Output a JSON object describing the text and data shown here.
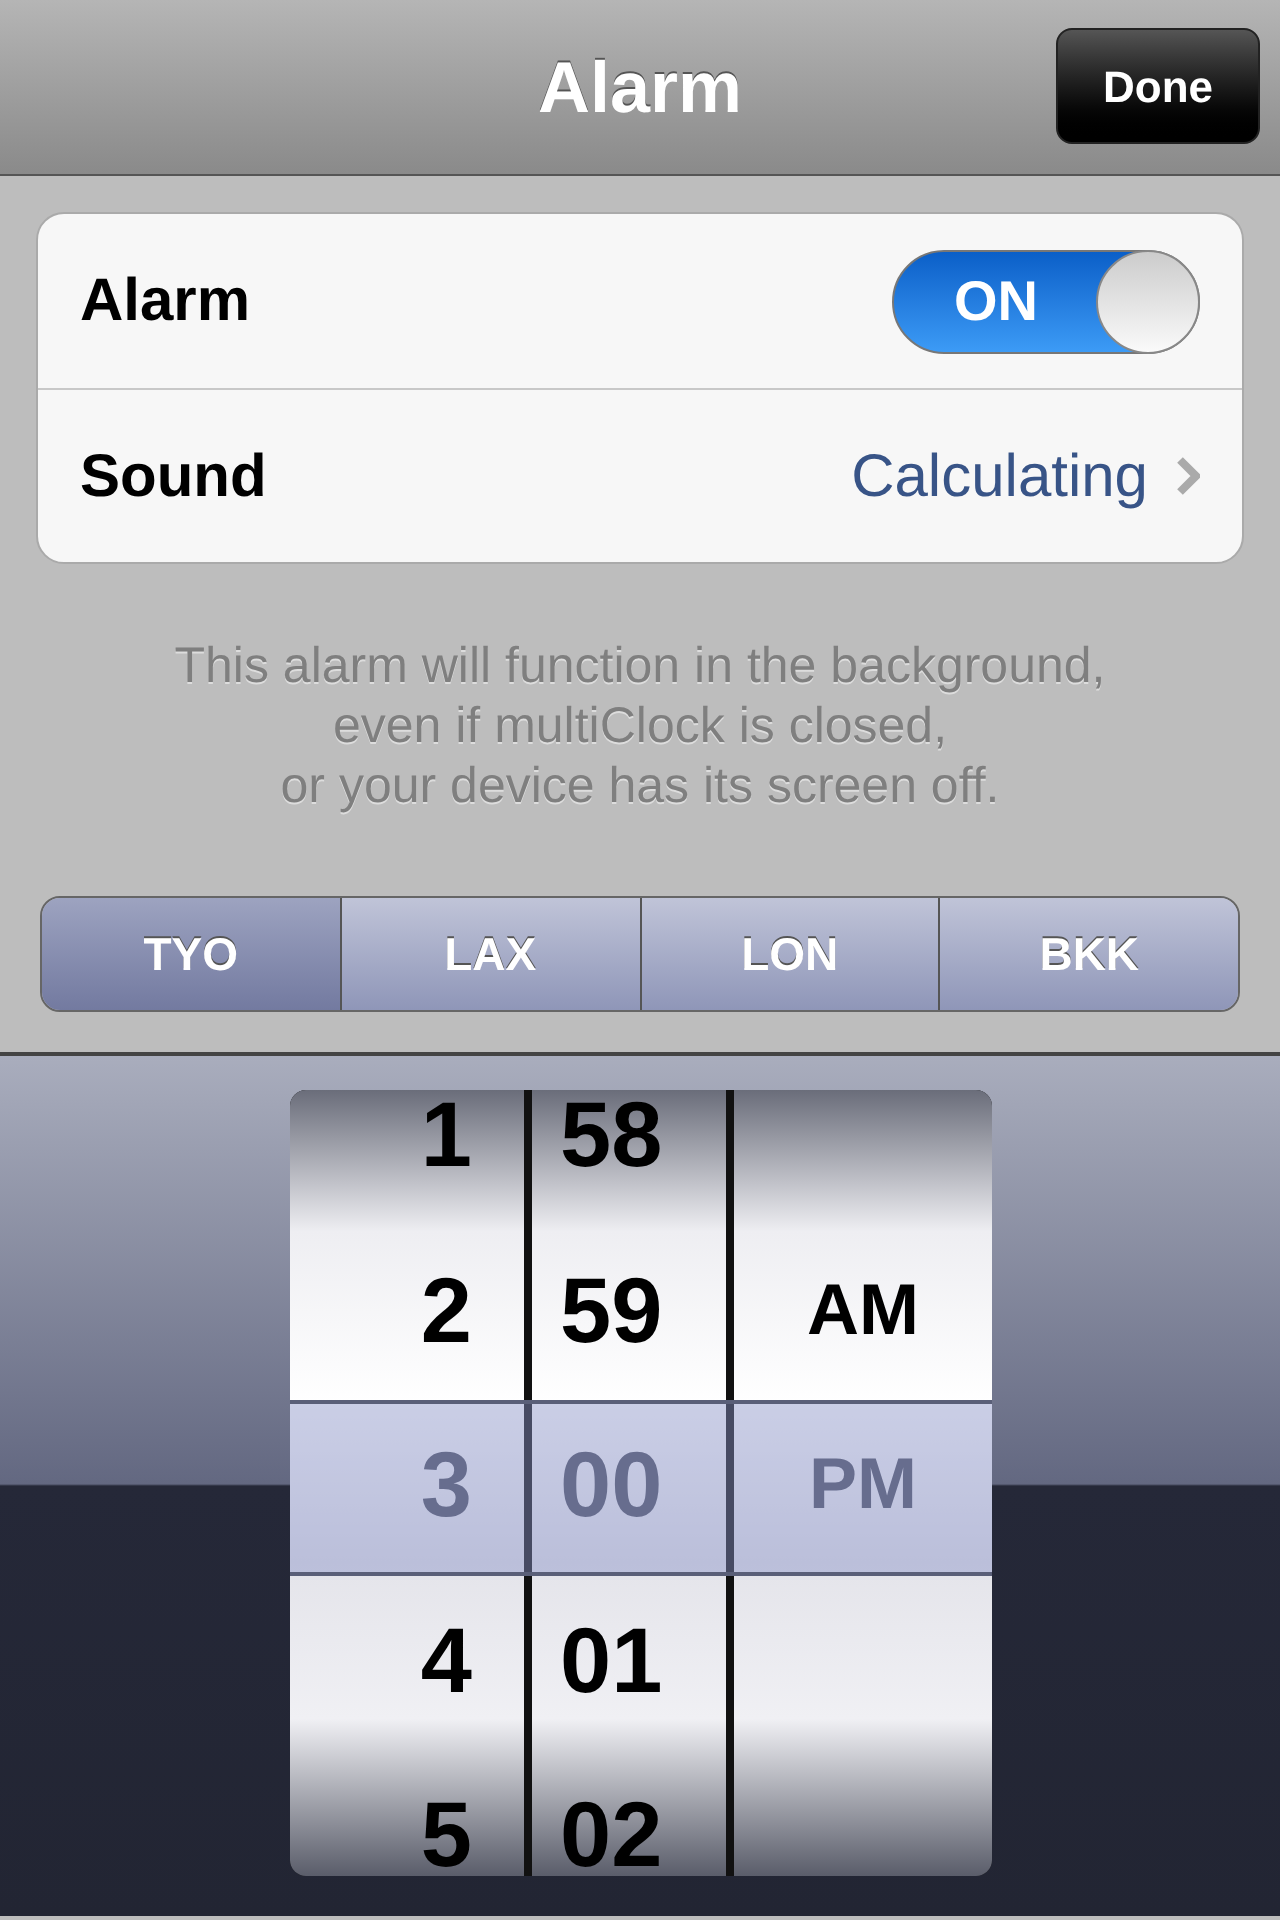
{
  "nav_bar": {
    "title": "Alarm",
    "done_button": "Done"
  },
  "settings": [
    {
      "kind": "toggle",
      "label": "Alarm",
      "on": true,
      "switch_label": "ON"
    },
    {
      "kind": "disclosure",
      "label": "Sound",
      "value": "Calculating"
    }
  ],
  "footer_lines": [
    "This alarm will function in the background,",
    "even if multiClock is closed,",
    "or your device has its screen off."
  ],
  "city_tabs": [
    {
      "label": "TYO",
      "selected": true
    },
    {
      "label": "LAX",
      "selected": false
    },
    {
      "label": "LON",
      "selected": false
    },
    {
      "label": "BKK",
      "selected": false
    }
  ],
  "time_picker": [
    {
      "kind": "hours",
      "items": [
        {
          "text": "1",
          "selected": false
        },
        {
          "text": "2",
          "selected": false
        },
        {
          "text": "3",
          "selected": true
        },
        {
          "text": "4",
          "selected": false
        },
        {
          "text": "5",
          "selected": false
        }
      ]
    },
    {
      "kind": "minutes",
      "items": [
        {
          "text": "58",
          "selected": false
        },
        {
          "text": "59",
          "selected": false
        },
        {
          "text": "00",
          "selected": true
        },
        {
          "text": "01",
          "selected": false
        },
        {
          "text": "02",
          "selected": false
        }
      ]
    },
    {
      "kind": "period",
      "items": [
        {
          "text": "AM",
          "selected": false
        },
        {
          "text": "PM",
          "selected": true
        }
      ]
    }
  ]
}
